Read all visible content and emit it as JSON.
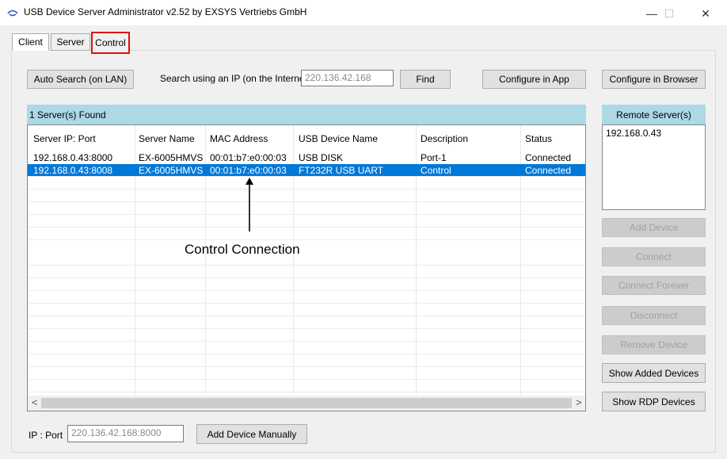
{
  "window": {
    "title": "USB Device Server Administrator v2.52 by EXSYS Vertriebs GmbH",
    "minimize": "—",
    "maximize": "☐",
    "close": "✕"
  },
  "tabs": [
    {
      "label": "Client"
    },
    {
      "label": "Server"
    },
    {
      "label": "Control"
    }
  ],
  "toolbar": {
    "auto_search": "Auto Search (on LAN)",
    "search_label": "Search using an IP (on the Internet)",
    "search_value": "220.136.42.168",
    "find": "Find",
    "configure_app": "Configure in App",
    "configure_browser": "Configure in Browser"
  },
  "list": {
    "header": "1 Server(s) Found",
    "columns": [
      "Server IP: Port",
      "Server Name",
      "MAC Address",
      "USB Device Name",
      "Description",
      "Status"
    ],
    "rows": [
      [
        "192.168.0.43:8000",
        "EX-6005HMVS",
        "00:01:b7:e0:00:03",
        "USB DISK",
        "Port-1",
        "Connected"
      ],
      [
        "192.168.0.43:8008",
        "EX-6005HMVS",
        "00:01:b7:e0:00:03",
        "FT232R USB UART",
        "Control",
        "Connected"
      ]
    ],
    "scroll_left": "<",
    "scroll_right": ">"
  },
  "annotation": "Control Connection",
  "remote": {
    "header": "Remote Server(s)",
    "items": [
      "192.168.0.43"
    ]
  },
  "side_buttons": {
    "add_device": "Add Device",
    "connect": "Connect",
    "connect_forever": "Connect Forever",
    "disconnect": "Disconnect",
    "remove_device": "Remove Device",
    "show_added": "Show Added Devices",
    "show_rdp": "Show RDP Devices"
  },
  "manual": {
    "label": "IP : Port",
    "value": "220.136.42.168:8000",
    "add_button": "Add Device Manually"
  }
}
